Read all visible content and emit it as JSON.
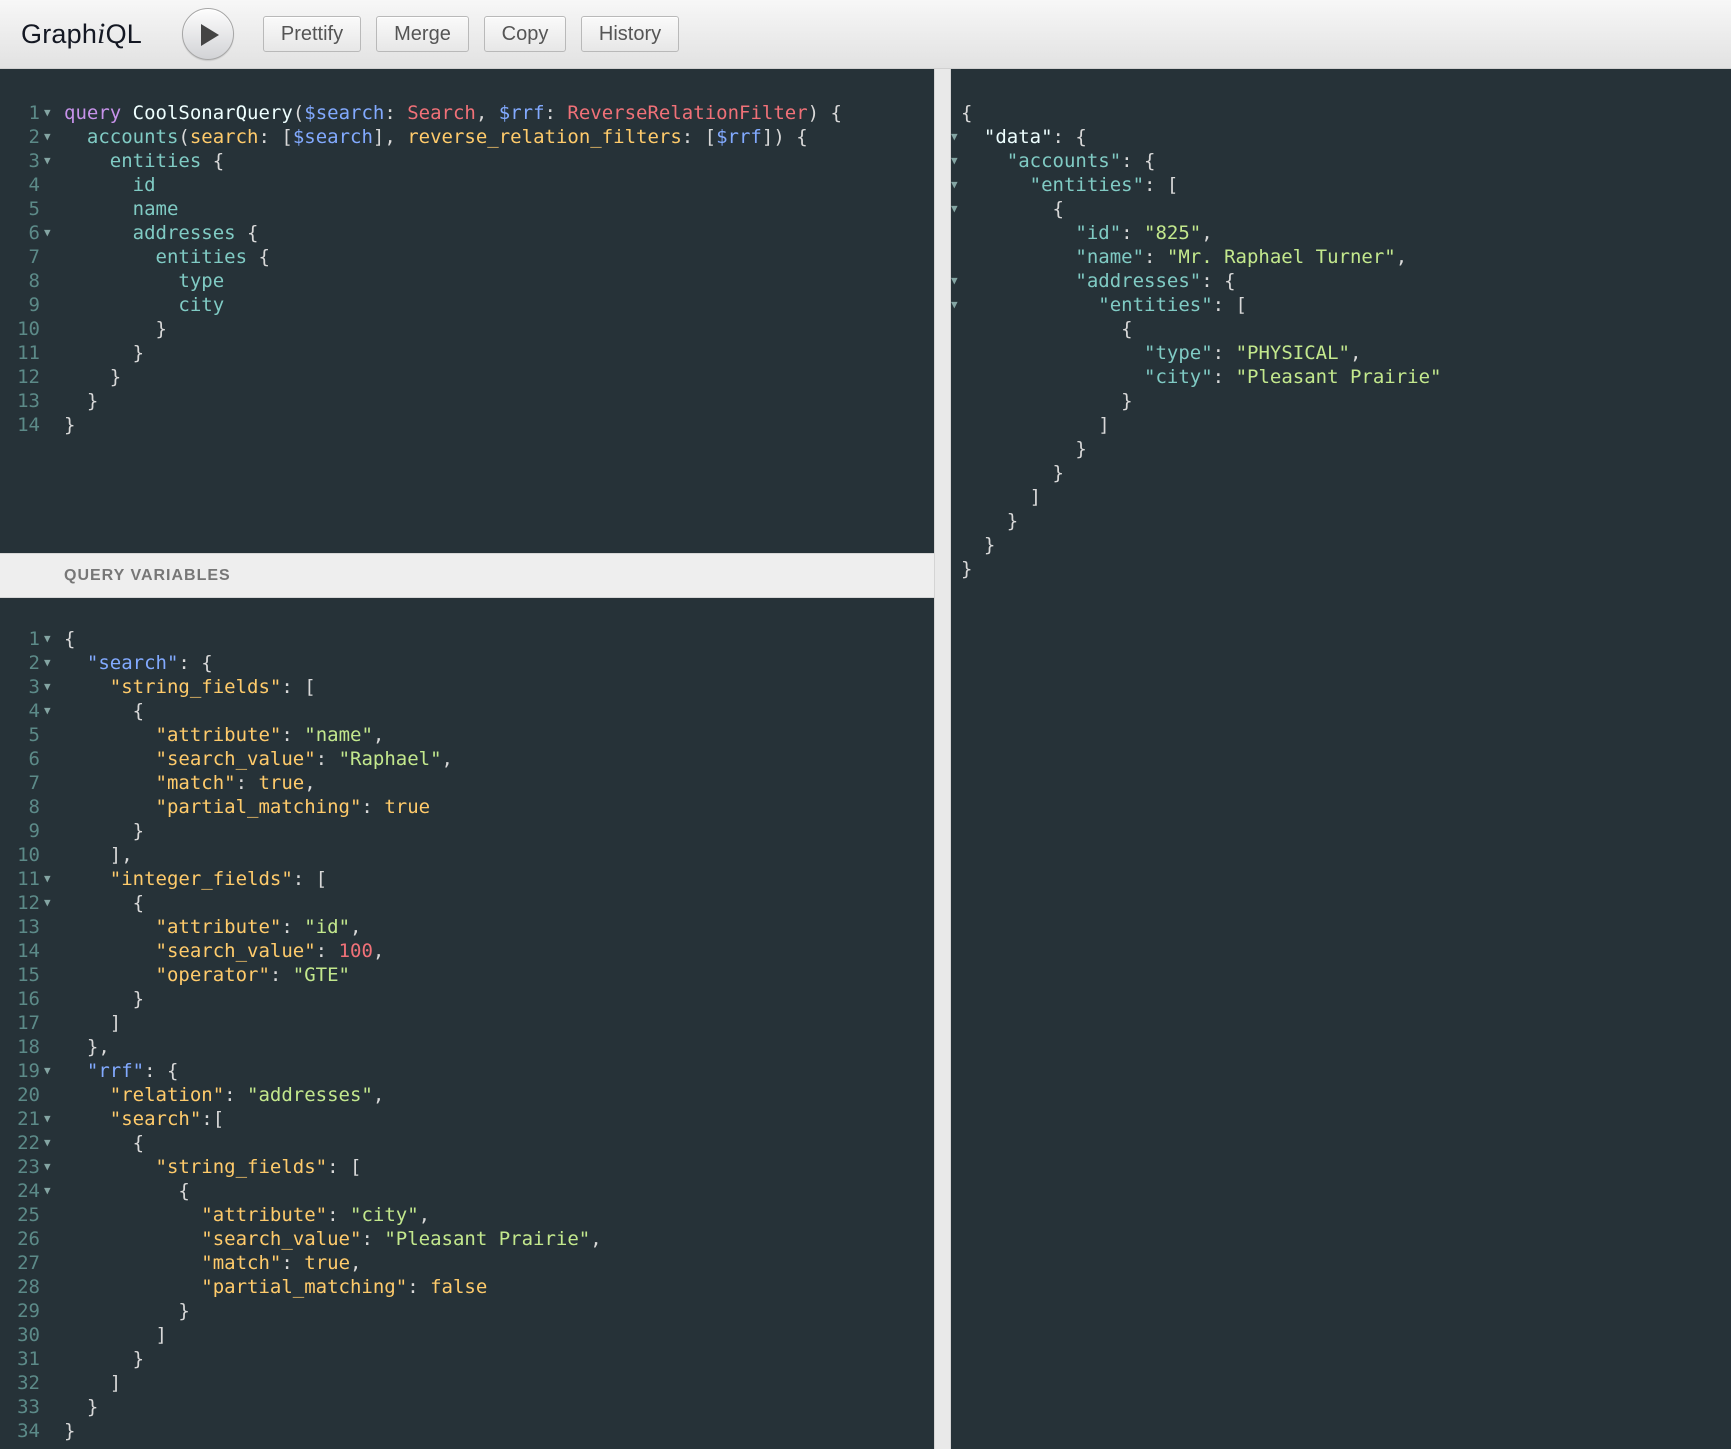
{
  "app": {
    "logo_prefix": "Graph",
    "logo_i": "i",
    "logo_suffix": "QL"
  },
  "toolbar": {
    "prettify_label": "Prettify",
    "merge_label": "Merge",
    "copy_label": "Copy",
    "history_label": "History"
  },
  "variables_header": "QUERY VARIABLES",
  "colors": {
    "editor_bg": "#263238",
    "keyword": "#c792ea",
    "variable": "#82aaff",
    "type": "#f07178",
    "field": "#80cbc4",
    "json_key": "#ffcb6b",
    "json_string": "#c3e88d"
  },
  "query_lines": [
    [
      [
        "kw",
        "query"
      ],
      [
        "punc",
        " "
      ],
      [
        "def",
        "CoolSonarQuery"
      ],
      [
        "punc",
        "("
      ],
      [
        "var",
        "$search"
      ],
      [
        "punc",
        ": "
      ],
      [
        "type",
        "Search"
      ],
      [
        "punc",
        ", "
      ],
      [
        "var",
        "$rrf"
      ],
      [
        "punc",
        ": "
      ],
      [
        "type",
        "ReverseRelationFilter"
      ],
      [
        "punc",
        ") {"
      ]
    ],
    [
      [
        "punc",
        "  "
      ],
      [
        "field",
        "accounts"
      ],
      [
        "punc",
        "("
      ],
      [
        "arg",
        "search"
      ],
      [
        "punc",
        ": ["
      ],
      [
        "var",
        "$search"
      ],
      [
        "punc",
        "], "
      ],
      [
        "arg",
        "reverse_relation_filters"
      ],
      [
        "punc",
        ": ["
      ],
      [
        "var",
        "$rrf"
      ],
      [
        "punc",
        "]) {"
      ]
    ],
    [
      [
        "punc",
        "    "
      ],
      [
        "field",
        "entities"
      ],
      [
        "punc",
        " {"
      ]
    ],
    [
      [
        "punc",
        "      "
      ],
      [
        "field",
        "id"
      ]
    ],
    [
      [
        "punc",
        "      "
      ],
      [
        "field",
        "name"
      ]
    ],
    [
      [
        "punc",
        "      "
      ],
      [
        "field",
        "addresses"
      ],
      [
        "punc",
        " {"
      ]
    ],
    [
      [
        "punc",
        "        "
      ],
      [
        "field",
        "entities"
      ],
      [
        "punc",
        " {"
      ]
    ],
    [
      [
        "punc",
        "          "
      ],
      [
        "field",
        "type"
      ]
    ],
    [
      [
        "punc",
        "          "
      ],
      [
        "field",
        "city"
      ]
    ],
    [
      [
        "punc",
        "        }"
      ]
    ],
    [
      [
        "punc",
        "      }"
      ]
    ],
    [
      [
        "punc",
        "    }"
      ]
    ],
    [
      [
        "punc",
        "  }"
      ]
    ],
    [
      [
        "punc",
        "}"
      ]
    ]
  ],
  "query_folds": [
    1,
    2,
    3,
    6
  ],
  "variables_lines": [
    [
      [
        "punc",
        "{"
      ]
    ],
    [
      [
        "punc",
        "  "
      ],
      [
        "var",
        "\"search\""
      ],
      [
        "punc",
        ": {"
      ]
    ],
    [
      [
        "punc",
        "    "
      ],
      [
        "key",
        "\"string_fields\""
      ],
      [
        "punc",
        ": ["
      ]
    ],
    [
      [
        "punc",
        "      {"
      ]
    ],
    [
      [
        "punc",
        "        "
      ],
      [
        "key",
        "\"attribute\""
      ],
      [
        "punc",
        ": "
      ],
      [
        "str",
        "\"name\""
      ],
      [
        "punc",
        ","
      ]
    ],
    [
      [
        "punc",
        "        "
      ],
      [
        "key",
        "\"search_value\""
      ],
      [
        "punc",
        ": "
      ],
      [
        "str",
        "\"Raphael\""
      ],
      [
        "punc",
        ","
      ]
    ],
    [
      [
        "punc",
        "        "
      ],
      [
        "key",
        "\"match\""
      ],
      [
        "punc",
        ": "
      ],
      [
        "bool",
        "true"
      ],
      [
        "punc",
        ","
      ]
    ],
    [
      [
        "punc",
        "        "
      ],
      [
        "key",
        "\"partial_matching\""
      ],
      [
        "punc",
        ": "
      ],
      [
        "bool",
        "true"
      ]
    ],
    [
      [
        "punc",
        "      }"
      ]
    ],
    [
      [
        "punc",
        "    ],"
      ]
    ],
    [
      [
        "punc",
        "    "
      ],
      [
        "key",
        "\"integer_fields\""
      ],
      [
        "punc",
        ": ["
      ]
    ],
    [
      [
        "punc",
        "      {"
      ]
    ],
    [
      [
        "punc",
        "        "
      ],
      [
        "key",
        "\"attribute\""
      ],
      [
        "punc",
        ": "
      ],
      [
        "str",
        "\"id\""
      ],
      [
        "punc",
        ","
      ]
    ],
    [
      [
        "punc",
        "        "
      ],
      [
        "key",
        "\"search_value\""
      ],
      [
        "punc",
        ": "
      ],
      [
        "num",
        "100"
      ],
      [
        "punc",
        ","
      ]
    ],
    [
      [
        "punc",
        "        "
      ],
      [
        "key",
        "\"operator\""
      ],
      [
        "punc",
        ": "
      ],
      [
        "str",
        "\"GTE\""
      ]
    ],
    [
      [
        "punc",
        "      }"
      ]
    ],
    [
      [
        "punc",
        "    ]"
      ]
    ],
    [
      [
        "punc",
        "  },"
      ]
    ],
    [
      [
        "punc",
        "  "
      ],
      [
        "var",
        "\"rrf\""
      ],
      [
        "punc",
        ": {"
      ]
    ],
    [
      [
        "punc",
        "    "
      ],
      [
        "key",
        "\"relation\""
      ],
      [
        "punc",
        ": "
      ],
      [
        "str",
        "\"addresses\""
      ],
      [
        "punc",
        ","
      ]
    ],
    [
      [
        "punc",
        "    "
      ],
      [
        "key",
        "\"search\""
      ],
      [
        "punc",
        ":["
      ]
    ],
    [
      [
        "punc",
        "      {"
      ]
    ],
    [
      [
        "punc",
        "        "
      ],
      [
        "key",
        "\"string_fields\""
      ],
      [
        "punc",
        ": ["
      ]
    ],
    [
      [
        "punc",
        "          {"
      ]
    ],
    [
      [
        "punc",
        "            "
      ],
      [
        "key",
        "\"attribute\""
      ],
      [
        "punc",
        ": "
      ],
      [
        "str",
        "\"city\""
      ],
      [
        "punc",
        ","
      ]
    ],
    [
      [
        "punc",
        "            "
      ],
      [
        "key",
        "\"search_value\""
      ],
      [
        "punc",
        ": "
      ],
      [
        "str",
        "\"Pleasant Prairie\""
      ],
      [
        "punc",
        ","
      ]
    ],
    [
      [
        "punc",
        "            "
      ],
      [
        "key",
        "\"match\""
      ],
      [
        "punc",
        ": "
      ],
      [
        "bool",
        "true"
      ],
      [
        "punc",
        ","
      ]
    ],
    [
      [
        "punc",
        "            "
      ],
      [
        "key",
        "\"partial_matching\""
      ],
      [
        "punc",
        ": "
      ],
      [
        "bool",
        "false"
      ]
    ],
    [
      [
        "punc",
        "          }"
      ]
    ],
    [
      [
        "punc",
        "        ]"
      ]
    ],
    [
      [
        "punc",
        "      }"
      ]
    ],
    [
      [
        "punc",
        "    ]"
      ]
    ],
    [
      [
        "punc",
        "  }"
      ]
    ],
    [
      [
        "punc",
        "}"
      ]
    ]
  ],
  "variables_folds": [
    1,
    2,
    3,
    4,
    11,
    12,
    19,
    21,
    22,
    23,
    24
  ],
  "result_lines": [
    [
      [
        "punc",
        "{"
      ]
    ],
    [
      [
        "punc",
        "  "
      ],
      [
        "rkey0",
        "\"data\""
      ],
      [
        "punc",
        ": {"
      ]
    ],
    [
      [
        "punc",
        "    "
      ],
      [
        "rkey",
        "\"accounts\""
      ],
      [
        "punc",
        ": {"
      ]
    ],
    [
      [
        "punc",
        "      "
      ],
      [
        "rkey",
        "\"entities\""
      ],
      [
        "punc",
        ": ["
      ]
    ],
    [
      [
        "punc",
        "        {"
      ]
    ],
    [
      [
        "punc",
        "          "
      ],
      [
        "rkey",
        "\"id\""
      ],
      [
        "punc",
        ": "
      ],
      [
        "str",
        "\"825\""
      ],
      [
        "punc",
        ","
      ]
    ],
    [
      [
        "punc",
        "          "
      ],
      [
        "rkey",
        "\"name\""
      ],
      [
        "punc",
        ": "
      ],
      [
        "str",
        "\"Mr. Raphael Turner\""
      ],
      [
        "punc",
        ","
      ]
    ],
    [
      [
        "punc",
        "          "
      ],
      [
        "rkey",
        "\"addresses\""
      ],
      [
        "punc",
        ": {"
      ]
    ],
    [
      [
        "punc",
        "            "
      ],
      [
        "rkey",
        "\"entities\""
      ],
      [
        "punc",
        ": ["
      ]
    ],
    [
      [
        "punc",
        "              {"
      ]
    ],
    [
      [
        "punc",
        "                "
      ],
      [
        "rkey",
        "\"type\""
      ],
      [
        "punc",
        ": "
      ],
      [
        "str",
        "\"PHYSICAL\""
      ],
      [
        "punc",
        ","
      ]
    ],
    [
      [
        "punc",
        "                "
      ],
      [
        "rkey",
        "\"city\""
      ],
      [
        "punc",
        ": "
      ],
      [
        "str",
        "\"Pleasant Prairie\""
      ]
    ],
    [
      [
        "punc",
        "              }"
      ]
    ],
    [
      [
        "punc",
        "            ]"
      ]
    ],
    [
      [
        "punc",
        "          }"
      ]
    ],
    [
      [
        "punc",
        "        }"
      ]
    ],
    [
      [
        "punc",
        "      ]"
      ]
    ],
    [
      [
        "punc",
        "    }"
      ]
    ],
    [
      [
        "punc",
        "  }"
      ]
    ],
    [
      [
        "punc",
        "}"
      ]
    ]
  ],
  "result_folds": [
    2,
    3,
    4,
    5,
    8,
    9
  ]
}
